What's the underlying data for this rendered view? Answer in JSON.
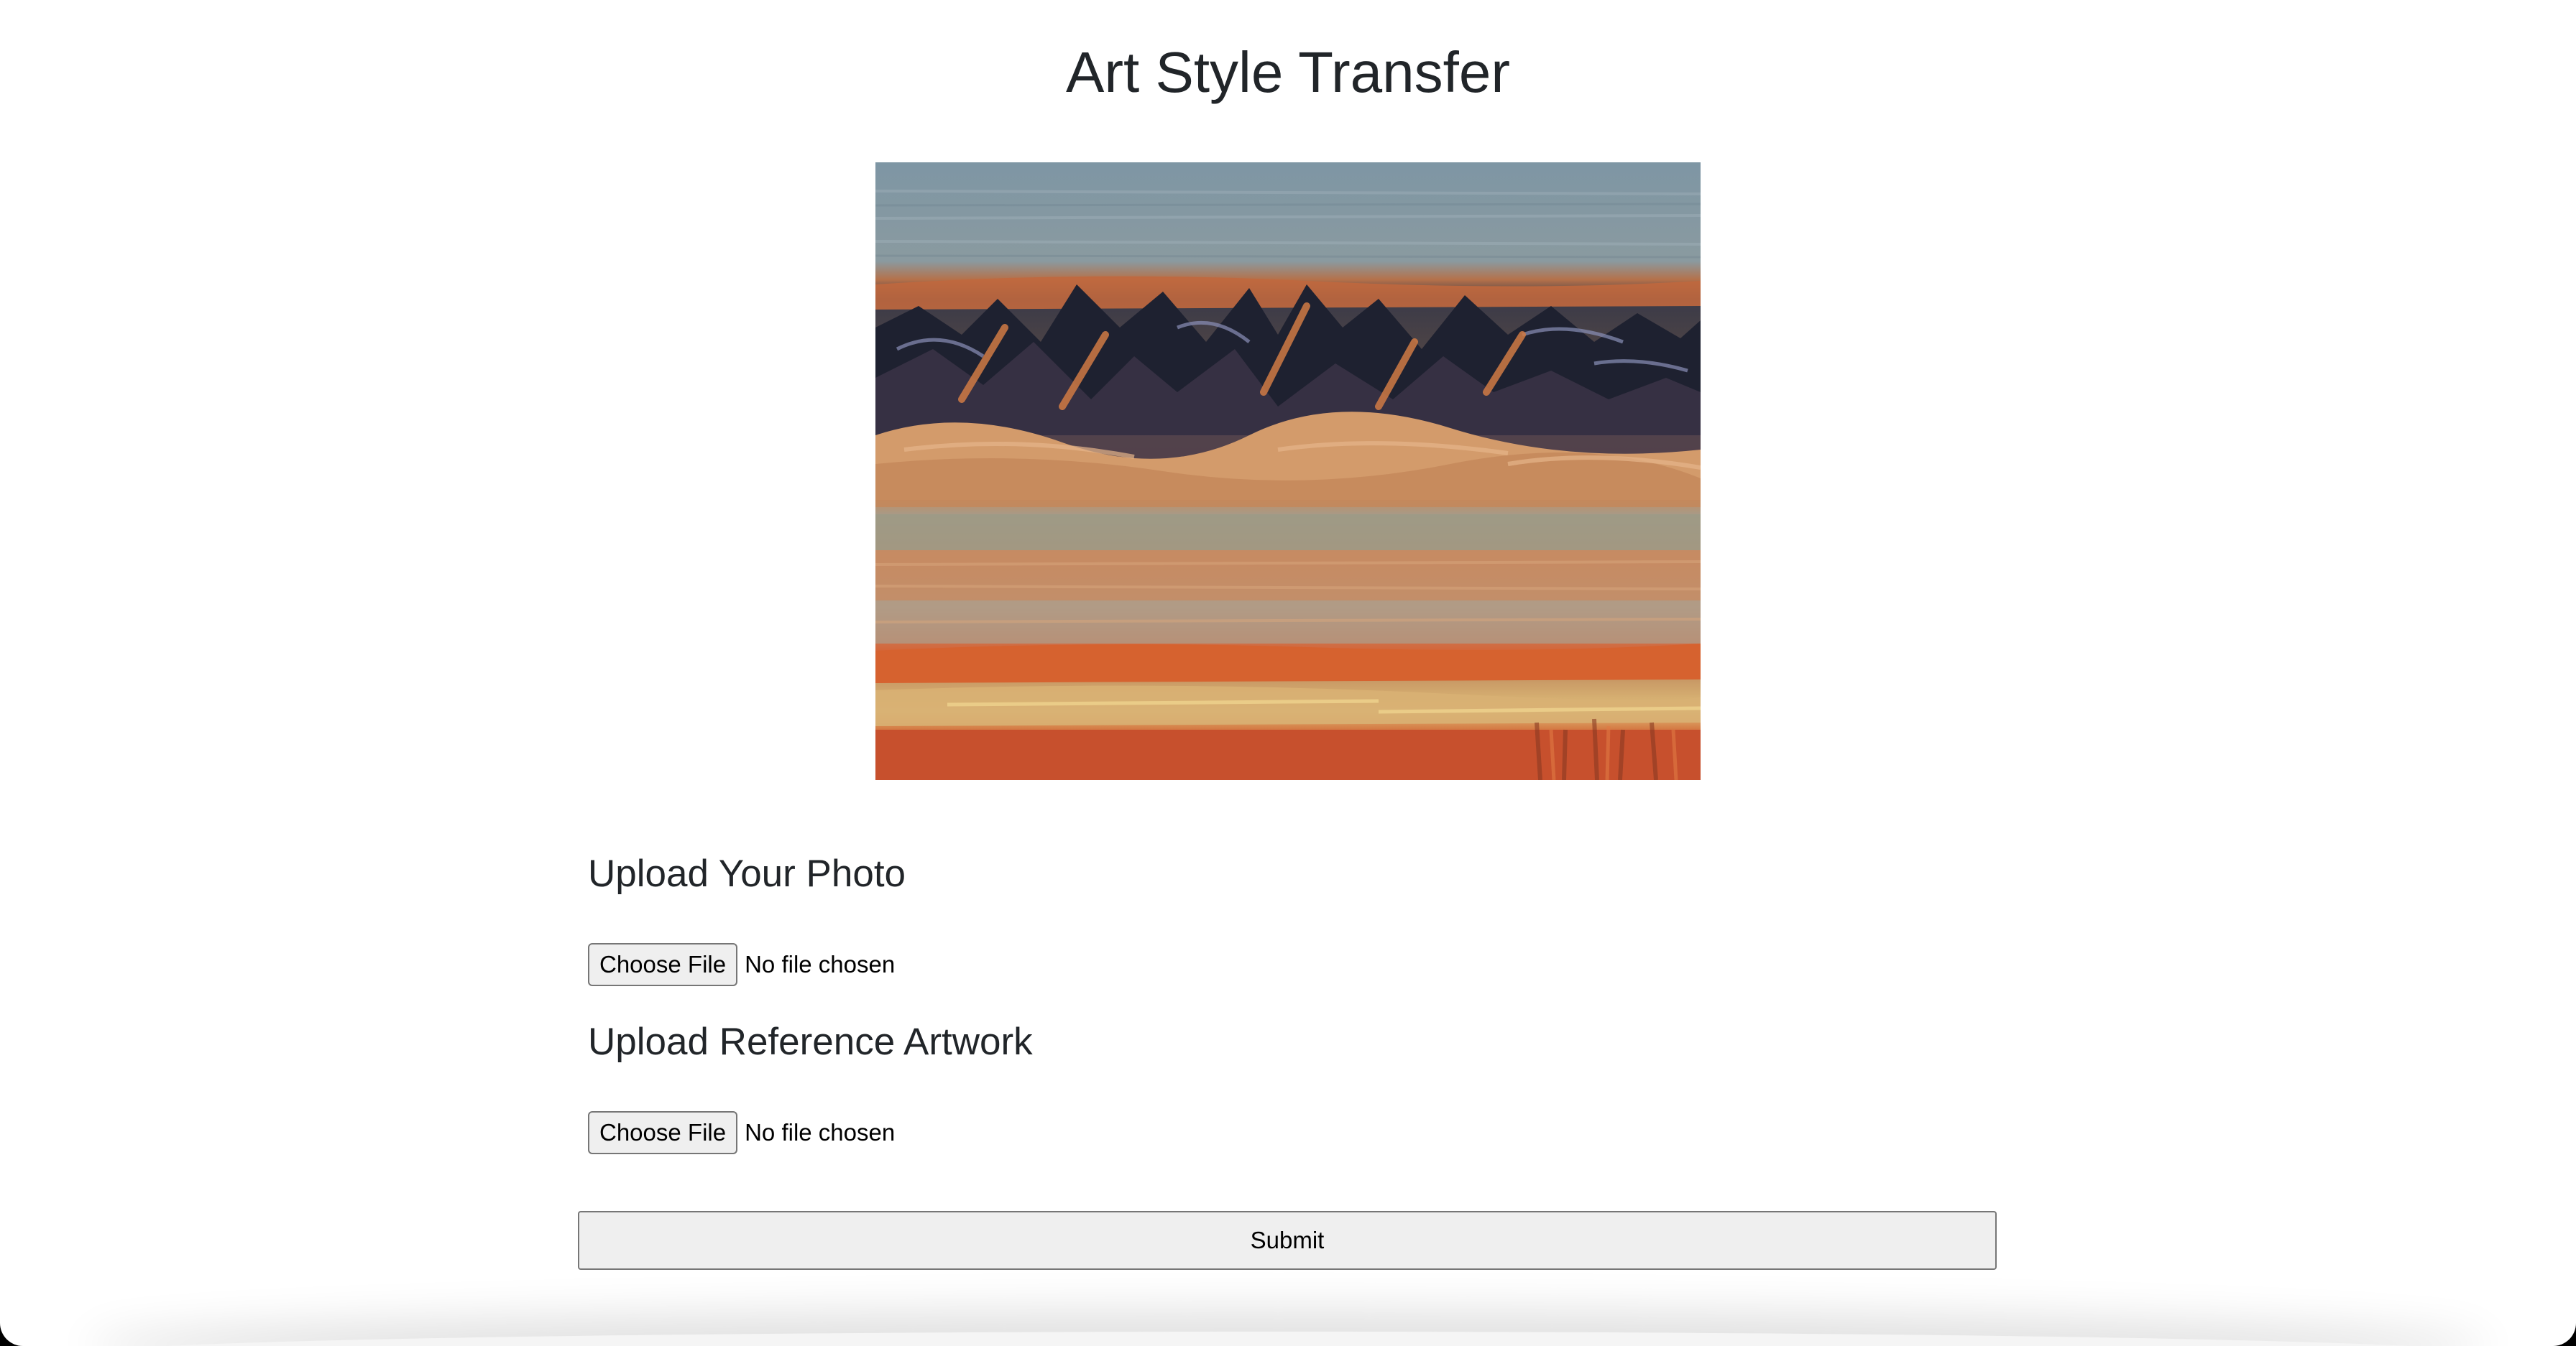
{
  "page": {
    "title": "Art Style Transfer"
  },
  "artwork": {
    "description_icon": "stylized-landscape-image",
    "palette": {
      "sky": "#7f95a3",
      "dark": "#1f2233",
      "orange": "#d2693a",
      "sand": "#c99a6c",
      "cream": "#d9c48a"
    }
  },
  "form": {
    "photo": {
      "heading": "Upload Your Photo",
      "button_label": "Choose File",
      "status": "No file chosen"
    },
    "reference": {
      "heading": "Upload Reference Artwork",
      "button_label": "Choose File",
      "status": "No file chosen"
    },
    "submit_label": "Submit"
  }
}
